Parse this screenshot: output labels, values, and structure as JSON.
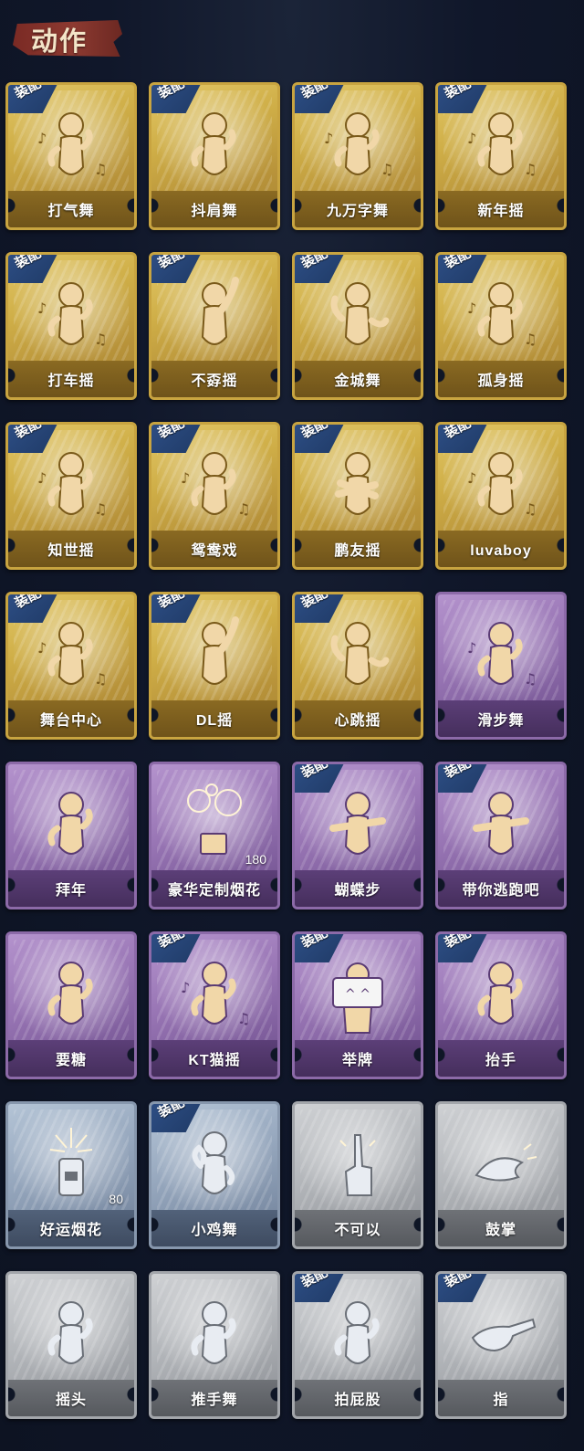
{
  "header": {
    "title": "动作"
  },
  "badge_label": "装配",
  "colors": {
    "gold": "#cfae47",
    "purple": "#9a77b6",
    "blue": "#98a9bf",
    "gray": "#b5b8bc",
    "badge": "#2e4f86",
    "header_ribbon": "#8d3a31"
  },
  "actions": [
    {
      "label": "打气舞",
      "rarity": "gold",
      "equipped": true,
      "icon": "dancer-music-icon"
    },
    {
      "label": "抖肩舞",
      "rarity": "gold",
      "equipped": true,
      "icon": "shoulder-shake-icon"
    },
    {
      "label": "九万字舞",
      "rarity": "gold",
      "equipped": true,
      "icon": "dancer-swirl-icon"
    },
    {
      "label": "新年摇",
      "rarity": "gold",
      "equipped": true,
      "icon": "dancer-wave-icon"
    },
    {
      "label": "打车摇",
      "rarity": "gold",
      "equipped": true,
      "icon": "dancer-music-icon"
    },
    {
      "label": "不孬摇",
      "rarity": "gold",
      "equipped": true,
      "icon": "dancer-arm-up-icon"
    },
    {
      "label": "金城舞",
      "rarity": "gold",
      "equipped": true,
      "icon": "dancer-hands-icon"
    },
    {
      "label": "孤身摇",
      "rarity": "gold",
      "equipped": true,
      "icon": "dancer-star-icon"
    },
    {
      "label": "知世摇",
      "rarity": "gold",
      "equipped": true,
      "icon": "dancer-music-icon"
    },
    {
      "label": "鸳鸯戏",
      "rarity": "gold",
      "equipped": true,
      "icon": "dancer-music-icon"
    },
    {
      "label": "鹏友摇",
      "rarity": "gold",
      "equipped": true,
      "icon": "dancer-cross-arms-icon"
    },
    {
      "label": "luvaboy",
      "rarity": "gold",
      "equipped": true,
      "icon": "dancer-twist-icon"
    },
    {
      "label": "舞台中心",
      "rarity": "gold",
      "equipped": true,
      "icon": "dancer-star-icon"
    },
    {
      "label": "DL摇",
      "rarity": "gold",
      "equipped": true,
      "icon": "dancer-arm-up-icon"
    },
    {
      "label": "心跳摇",
      "rarity": "gold",
      "equipped": true,
      "icon": "dancer-hands-icon"
    },
    {
      "label": "滑步舞",
      "rarity": "purple",
      "equipped": false,
      "icon": "dancer-music-icon"
    },
    {
      "label": "拜年",
      "rarity": "purple",
      "equipped": false,
      "icon": "person-bow-icon"
    },
    {
      "label": "豪华定制烟花",
      "rarity": "purple",
      "equipped": false,
      "icon": "fireworks-box-icon",
      "count": "180"
    },
    {
      "label": "蝴蝶步",
      "rarity": "purple",
      "equipped": true,
      "icon": "dancer-point-icon"
    },
    {
      "label": "带你逃跑吧",
      "rarity": "purple",
      "equipped": true,
      "icon": "dancer-point-icon"
    },
    {
      "label": "要糖",
      "rarity": "purple",
      "equipped": false,
      "icon": "person-reach-icon"
    },
    {
      "label": "KT猫摇",
      "rarity": "purple",
      "equipped": true,
      "icon": "dancer-music-icon"
    },
    {
      "label": "举牌",
      "rarity": "purple",
      "equipped": true,
      "icon": "person-sign-icon"
    },
    {
      "label": "抬手",
      "rarity": "purple",
      "equipped": true,
      "icon": "person-raise-hand-icon"
    },
    {
      "label": "好运烟花",
      "rarity": "blue",
      "equipped": false,
      "icon": "firework-can-icon",
      "count": "80"
    },
    {
      "label": "小鸡舞",
      "rarity": "blue",
      "equipped": true,
      "icon": "chicken-dance-icon"
    },
    {
      "label": "不可以",
      "rarity": "gray",
      "equipped": false,
      "icon": "finger-wag-icon"
    },
    {
      "label": "鼓掌",
      "rarity": "gray",
      "equipped": false,
      "icon": "clap-hands-icon"
    },
    {
      "label": "摇头",
      "rarity": "gray",
      "equipped": false,
      "icon": "person-shake-head-icon"
    },
    {
      "label": "推手舞",
      "rarity": "gray",
      "equipped": false,
      "icon": "person-push-icon"
    },
    {
      "label": "拍屁股",
      "rarity": "gray",
      "equipped": true,
      "icon": "person-pat-icon"
    },
    {
      "label": "指",
      "rarity": "gray",
      "equipped": true,
      "icon": "point-hand-icon"
    }
  ]
}
